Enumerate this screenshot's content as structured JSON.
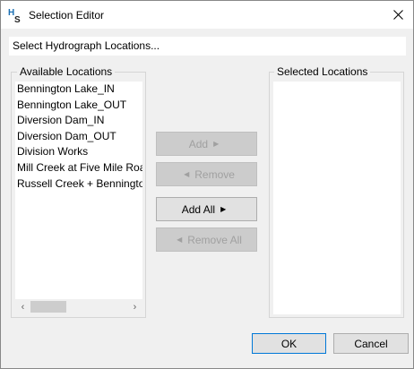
{
  "window": {
    "title": "Selection Editor",
    "app_icon": "hs-app-icon"
  },
  "header_field": {
    "text": "Select Hydrograph Locations..."
  },
  "available": {
    "label": "Available Locations",
    "items": [
      "Bennington Lake_IN",
      "Bennington Lake_OUT",
      "Diversion Dam_IN",
      "Diversion Dam_OUT",
      "Division Works",
      "Mill Creek at Five Mile Road",
      "Russell Creek + Bennington"
    ]
  },
  "selected": {
    "label": "Selected Locations",
    "items": []
  },
  "buttons": {
    "add": "Add",
    "remove": "Remove",
    "add_all": "Add All",
    "remove_all": "Remove All",
    "ok": "OK",
    "cancel": "Cancel"
  },
  "colors": {
    "background": "#f0f0f0",
    "accent": "#0078d7",
    "disabled_text": "#a0a0a0"
  }
}
